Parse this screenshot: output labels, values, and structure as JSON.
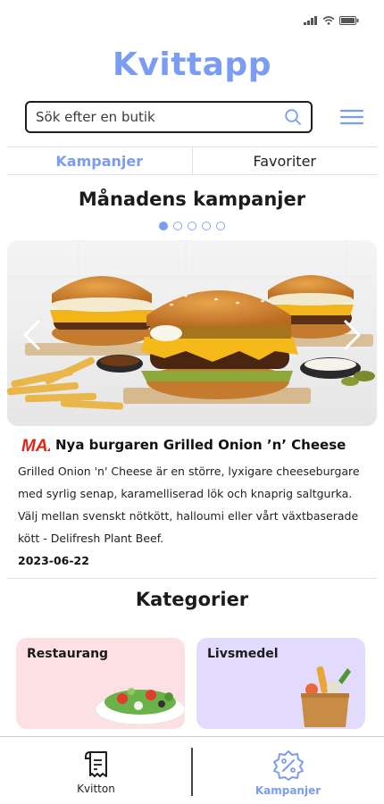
{
  "app": {
    "title": "Kvittapp"
  },
  "search": {
    "placeholder": "Sök efter en butik"
  },
  "tabs": [
    {
      "label": "Kampanjer",
      "active": true
    },
    {
      "label": "Favoriter",
      "active": false
    }
  ],
  "monthly": {
    "title": "Månadens kampanjer",
    "dots_total": 5,
    "dots_active": 1
  },
  "promo": {
    "brand_logo": "MAX",
    "title": "Nya burgaren Grilled Onion ’n’ Cheese",
    "description": "Grilled Onion 'n' Cheese är en större, lyxigare cheeseburgare med syrlig senap, karamelliserad lök och knaprig saltgurka. Välj mellan svenskt nötkött, halloumi eller vårt växtbaserade kött - Delifresh Plant Beef.",
    "date": "2023-06-22"
  },
  "categories": {
    "title": "Kategorier",
    "items": [
      {
        "label": "Restaurang",
        "color": "#fde0e3"
      },
      {
        "label": "Livsmedel",
        "color": "#e3dbfd"
      }
    ]
  },
  "nav": {
    "items": [
      {
        "label": "Kvitton",
        "icon": "receipt-icon",
        "active": false
      },
      {
        "label": "Kampanjer",
        "icon": "discount-badge-icon",
        "active": true
      }
    ]
  },
  "colors": {
    "accent": "#7a9cf3",
    "brand_red": "#e2231a"
  }
}
